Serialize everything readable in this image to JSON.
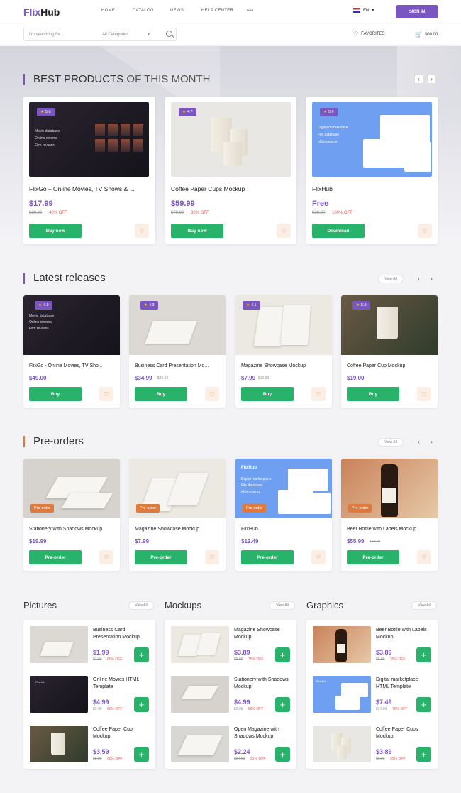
{
  "header": {
    "logo_a": "Flix",
    "logo_b": "Hub",
    "nav": [
      "HOME",
      "CATALOG",
      "NEWS",
      "HELP CENTER",
      "•••"
    ],
    "lang": "EN",
    "signin": "SIGN IN"
  },
  "search": {
    "placeholder": "I'm searching for...",
    "category": "All Categories",
    "favorites": "FAVORITES",
    "cart": "$00.00"
  },
  "best": {
    "title_bold": "BEST PRODUCTS",
    "title_light": "OF THIS MONTH",
    "items": [
      {
        "rating": "5.0",
        "title": "FlixGo – Online Movies, TV Shows & ...",
        "price": "$17.99",
        "old": "$29.99",
        "off": "40% OFF",
        "button": "Buy now"
      },
      {
        "rating": "4.7",
        "title": "Coffee Paper Cups Mockup",
        "price": "$59.99",
        "old": "$79.99",
        "off": "30% OFF",
        "button": "Buy now"
      },
      {
        "rating": "5.0",
        "title": "FlixHub",
        "price": "Free",
        "old": "$39.00",
        "off": "100% OFF",
        "button": "Download"
      }
    ]
  },
  "latest": {
    "title": "Latest releases",
    "view_all": "View All",
    "items": [
      {
        "rating": "4.9",
        "title": "FlixGo - Online Movies, TV Sho...",
        "price": "$49.00",
        "old": "",
        "button": "Buy"
      },
      {
        "rating": "4.3",
        "title": "Business Card Presentation Mo...",
        "price": "$34.99",
        "old": "$49.99",
        "button": "Buy"
      },
      {
        "rating": "4.1",
        "title": "Magazine Showcase Mockup",
        "price": "$7.99",
        "old": "$19.99",
        "button": "Buy"
      },
      {
        "rating": "5.0",
        "title": "Coffee Paper Cup Mockup",
        "price": "$19.00",
        "old": "",
        "button": "Buy"
      }
    ]
  },
  "preorders": {
    "title": "Pre-orders",
    "view_all": "View All",
    "badge": "Pre-order",
    "items": [
      {
        "title": "Stationery with Shadows Mockup",
        "price": "$19.99",
        "old": "",
        "button": "Pre-order"
      },
      {
        "title": "Magazine Showcase Mockup",
        "price": "$7.99",
        "old": "",
        "button": "Pre-order"
      },
      {
        "title": "FlixHub",
        "price": "$12.49",
        "old": "",
        "button": "Pre-order"
      },
      {
        "title": "Beer Bottle with Labels Mockup",
        "price": "$55.99",
        "old": "$79.99",
        "button": "Pre-order"
      }
    ]
  },
  "columns": [
    {
      "title": "Pictures",
      "view_all": "View All",
      "items": [
        {
          "title": "Business Card Presentation Mockup",
          "price": "$1.99",
          "old": "$4.00",
          "off": "60% OFF"
        },
        {
          "title": "Online Movies HTML Template",
          "price": "$4.99",
          "old": "$9.00",
          "off": "60% OFF"
        },
        {
          "title": "Coffee Paper Cup Mockup",
          "price": "$3.59",
          "old": "$5.00",
          "off": "60% OFF"
        }
      ]
    },
    {
      "title": "Mockups",
      "view_all": "View All",
      "items": [
        {
          "title": "Magazine Showcase Mockup",
          "price": "$3.89",
          "old": "$5.99",
          "off": "35% OFF"
        },
        {
          "title": "Stationery with Shadows Mockup",
          "price": "$4.99",
          "old": "$9.99",
          "off": "50% OFF"
        },
        {
          "title": "Open Magazine with Shadows Mockup",
          "price": "$2.24",
          "old": "$24.99",
          "off": "91% OFF"
        }
      ]
    },
    {
      "title": "Graphics",
      "view_all": "View All",
      "items": [
        {
          "title": "Beer Bottle with Labels Mockup",
          "price": "$3.89",
          "old": "$5.99",
          "off": "35% OFF"
        },
        {
          "title": "Digital marketplace HTML Template",
          "price": "$7.49",
          "old": "$24.99",
          "off": "70% OFF"
        },
        {
          "title": "Coffee Paper Cups Mockup",
          "price": "$3.89",
          "old": "$5.99",
          "off": "35% OFF"
        }
      ]
    }
  ],
  "thumb_text": {
    "dark_lines": [
      "Movie database",
      "Online cinema",
      "Film reviews"
    ],
    "blue_lines": [
      "Digital marketplace",
      "File database",
      "eCommerce"
    ],
    "flixhub_small": "FlixHub"
  },
  "colors": {
    "accent": "#7a56c1",
    "green": "#29b36a",
    "orange": "#e07a3c"
  }
}
